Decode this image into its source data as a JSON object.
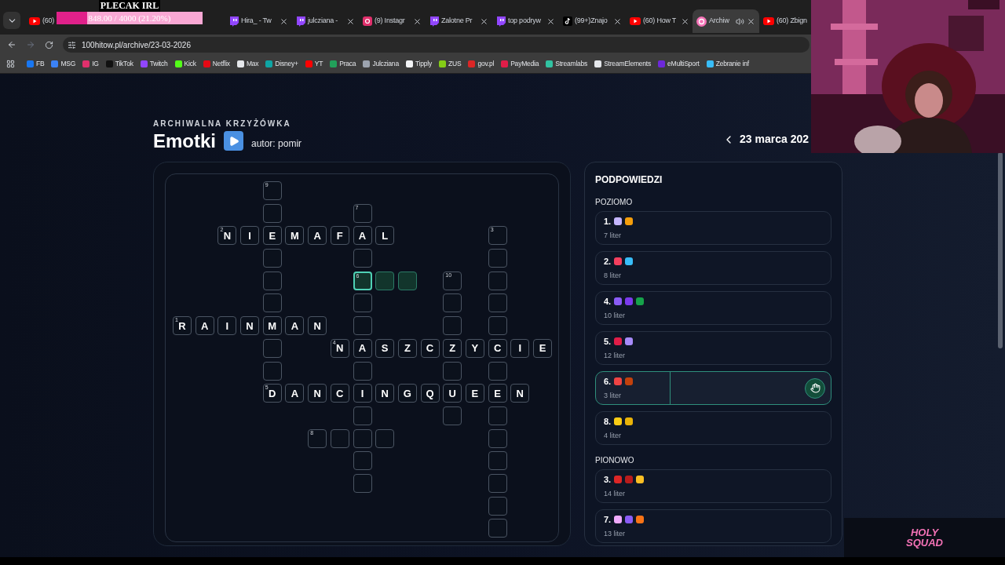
{
  "overlay": {
    "title": "PLECAK IRL",
    "reading": "848.00 / 4000 (21.20%)",
    "level": 0.212
  },
  "tabs": [
    {
      "label": "(60)",
      "kind": "video",
      "selected": false
    },
    {
      "label": "Hira_ - Tw",
      "kind": "stream",
      "selected": false
    },
    {
      "label": "julcziana -",
      "kind": "stream",
      "selected": false
    },
    {
      "label": "(9) Instagr",
      "selected": false
    },
    {
      "label": "Zalotne Pr",
      "kind": "stream",
      "selected": false
    },
    {
      "label": "top podryw",
      "kind": "stream",
      "selected": false
    },
    {
      "label": "(99+)Znajo",
      "kind": "music",
      "selected": false
    },
    {
      "label": "(60) How T",
      "kind": "video",
      "selected": false
    },
    {
      "label": "Archiw",
      "kind": "site",
      "selected": true
    },
    {
      "label": "(60) Zbign",
      "kind": "video",
      "selected": false
    }
  ],
  "address": "100hitow.pl/archive/23-03-2026",
  "bookmarks": [
    {
      "label": "FB",
      "color": "#1877f2"
    },
    {
      "label": "MSG",
      "color": "#3b82f6"
    },
    {
      "label": "IG",
      "color": "#e1306c"
    },
    {
      "label": "TikTok",
      "color": "#111111"
    },
    {
      "label": "Twitch",
      "color": "#9146ff"
    },
    {
      "label": "Kick",
      "color": "#53fc18"
    },
    {
      "label": "Netflix",
      "color": "#e50914"
    },
    {
      "label": "Max",
      "color": "#e5e7eb"
    },
    {
      "label": "Disney+",
      "color": "#0ea5a4"
    },
    {
      "label": "YT",
      "color": "#ff0000"
    },
    {
      "label": "Praca",
      "color": "#22a05a"
    },
    {
      "label": "Julcziana",
      "color": "#9ca3af"
    },
    {
      "label": "Tipply",
      "color": "#f3f4f6"
    },
    {
      "label": "ZUS",
      "color": "#84cc16"
    },
    {
      "label": "gov.pl",
      "color": "#dc2626"
    },
    {
      "label": "PayMedia",
      "color": "#e11d48"
    },
    {
      "label": "Streamlabs",
      "color": "#31c3a2"
    },
    {
      "label": "StreamElements",
      "color": "#e5e7eb"
    },
    {
      "label": "eMultiSport",
      "color": "#6d28d9"
    },
    {
      "label": "Zebranie inf",
      "color": "#38bdf8"
    }
  ],
  "header": {
    "kicker": "ARCHIWALNA KRZYŻÓWKA",
    "title": "Emotki",
    "author": "autor: pomir",
    "date": "23 marca 202"
  },
  "crossword": {
    "rows": [
      [
        null,
        null,
        null,
        null,
        {
          "number": "9",
          "active": false
        }
      ],
      [
        null,
        null,
        null,
        null,
        {
          "active": false
        },
        null,
        null,
        null,
        {
          "number": "7",
          "active": false
        }
      ],
      [
        null,
        null,
        {
          "number": "2",
          "letter": "N",
          "active": false
        },
        {
          "letter": "I",
          "active": false
        },
        {
          "letter": "E",
          "active": false
        },
        {
          "letter": "M",
          "active": false
        },
        {
          "letter": "A",
          "active": false
        },
        {
          "letter": "F",
          "active": false
        },
        {
          "letter": "A",
          "active": false
        },
        {
          "letter": "L",
          "active": false
        },
        null,
        null,
        null,
        null,
        {
          "number": "3",
          "active": false
        }
      ],
      [
        null,
        null,
        null,
        null,
        {
          "active": false
        },
        null,
        null,
        null,
        {
          "active": false
        },
        null,
        null,
        null,
        null,
        null,
        {
          "active": false
        }
      ],
      [
        null,
        null,
        null,
        null,
        {
          "active": false
        },
        null,
        null,
        null,
        {
          "number": "6",
          "active": true
        },
        {
          "active": true
        },
        {
          "active": true
        },
        null,
        {
          "number": "10",
          "active": false
        },
        null,
        {
          "active": false
        }
      ],
      [
        null,
        null,
        null,
        null,
        {
          "active": false
        },
        null,
        null,
        null,
        {
          "active": false
        },
        null,
        null,
        null,
        {
          "active": false
        },
        null,
        {
          "active": false
        }
      ],
      [
        {
          "number": "1",
          "letter": "R",
          "active": false
        },
        {
          "letter": "A",
          "active": false
        },
        {
          "letter": "I",
          "active": false
        },
        {
          "letter": "N",
          "active": false
        },
        {
          "letter": "M",
          "active": false
        },
        {
          "letter": "A",
          "active": false
        },
        {
          "letter": "N",
          "active": false
        },
        null,
        {
          "active": false
        },
        null,
        null,
        null,
        {
          "active": false
        },
        null,
        {
          "active": false
        }
      ],
      [
        null,
        null,
        null,
        null,
        {
          "active": false
        },
        null,
        null,
        {
          "number": "4",
          "letter": "N",
          "active": false
        },
        {
          "letter": "A",
          "active": false
        },
        {
          "letter": "S",
          "active": false
        },
        {
          "letter": "Z",
          "active": false
        },
        {
          "letter": "C",
          "active": false
        },
        {
          "letter": "Z",
          "active": false
        },
        {
          "letter": "Y",
          "active": false
        },
        {
          "letter": "C",
          "active": false
        },
        {
          "letter": "I",
          "active": false
        },
        {
          "letter": "E",
          "active": false
        }
      ],
      [
        null,
        null,
        null,
        null,
        {
          "active": false
        },
        null,
        null,
        null,
        {
          "active": false
        },
        null,
        null,
        null,
        {
          "active": false
        },
        null,
        {
          "active": false
        }
      ],
      [
        null,
        null,
        null,
        null,
        {
          "number": "5",
          "letter": "D",
          "active": false
        },
        {
          "letter": "A",
          "active": false
        },
        {
          "letter": "N",
          "active": false
        },
        {
          "letter": "C",
          "active": false
        },
        {
          "letter": "I",
          "active": false
        },
        {
          "letter": "N",
          "active": false
        },
        {
          "letter": "G",
          "active": false
        },
        {
          "letter": "Q",
          "active": false
        },
        {
          "letter": "U",
          "active": false
        },
        {
          "letter": "E",
          "active": false
        },
        {
          "letter": "E",
          "active": false
        },
        {
          "letter": "N",
          "active": false
        }
      ],
      [
        null,
        null,
        null,
        null,
        null,
        null,
        null,
        null,
        {
          "active": false
        },
        null,
        null,
        null,
        {
          "active": false
        },
        null,
        {
          "active": false
        }
      ],
      [
        null,
        null,
        null,
        null,
        null,
        null,
        {
          "number": "8",
          "active": false
        },
        {
          "active": false
        },
        {
          "active": false
        },
        {
          "active": false
        },
        null,
        null,
        null,
        null,
        {
          "active": false
        }
      ],
      [
        null,
        null,
        null,
        null,
        null,
        null,
        null,
        null,
        {
          "active": false
        },
        null,
        null,
        null,
        null,
        null,
        {
          "active": false
        }
      ],
      [
        null,
        null,
        null,
        null,
        null,
        null,
        null,
        null,
        {
          "active": false
        },
        null,
        null,
        null,
        null,
        null,
        {
          "active": false
        }
      ],
      [
        null,
        null,
        null,
        null,
        null,
        null,
        null,
        null,
        null,
        null,
        null,
        null,
        null,
        null,
        {
          "active": false
        }
      ],
      [
        null,
        null,
        null,
        null,
        null,
        null,
        null,
        null,
        null,
        null,
        null,
        null,
        null,
        null,
        {
          "active": false
        }
      ]
    ]
  },
  "clues": {
    "heading": "PODPOWIEDZI",
    "groups": [
      {
        "title": "POZIOMO",
        "items": [
          {
            "label": "1.",
            "count": "7 liter",
            "selected": false,
            "icons": [
              {
                "color": "#c4b5fd"
              },
              {
                "color": "#f59e0b"
              }
            ]
          },
          {
            "label": "2.",
            "count": "8 liter",
            "selected": false,
            "icons": [
              {
                "color": "#f43f5e"
              },
              {
                "color": "#38bdf8"
              }
            ]
          },
          {
            "label": "4.",
            "count": "10 liter",
            "selected": false,
            "icons": [
              {
                "color": "#8b5cf6"
              },
              {
                "color": "#7c3aed"
              },
              {
                "color": "#16a34a"
              }
            ]
          },
          {
            "label": "5.",
            "count": "12 liter",
            "selected": false,
            "icons": [
              {
                "color": "#e11d48"
              },
              {
                "color": "#a78bfa"
              }
            ]
          },
          {
            "label": "6.",
            "count": "3 liter",
            "selected": true,
            "icons": [
              {
                "color": "#ef4444"
              },
              {
                "color": "#c2410c"
              }
            ]
          },
          {
            "label": "8.",
            "count": "4 liter",
            "selected": false,
            "icons": [
              {
                "color": "#facc15"
              },
              {
                "color": "#eab308"
              }
            ]
          }
        ]
      },
      {
        "title": "PIONOWO",
        "items": [
          {
            "label": "3.",
            "count": "14 liter",
            "selected": false,
            "icons": [
              {
                "color": "#dc2626"
              },
              {
                "color": "#b91c1c"
              },
              {
                "color": "#fbbf24"
              }
            ]
          },
          {
            "label": "7.",
            "count": "13 liter",
            "selected": false,
            "icons": [
              {
                "color": "#f0abfc"
              },
              {
                "color": "#8b5cf6"
              },
              {
                "color": "#f97316"
              }
            ]
          }
        ]
      }
    ]
  },
  "logo": [
    "HOLY",
    "SQUAD"
  ]
}
